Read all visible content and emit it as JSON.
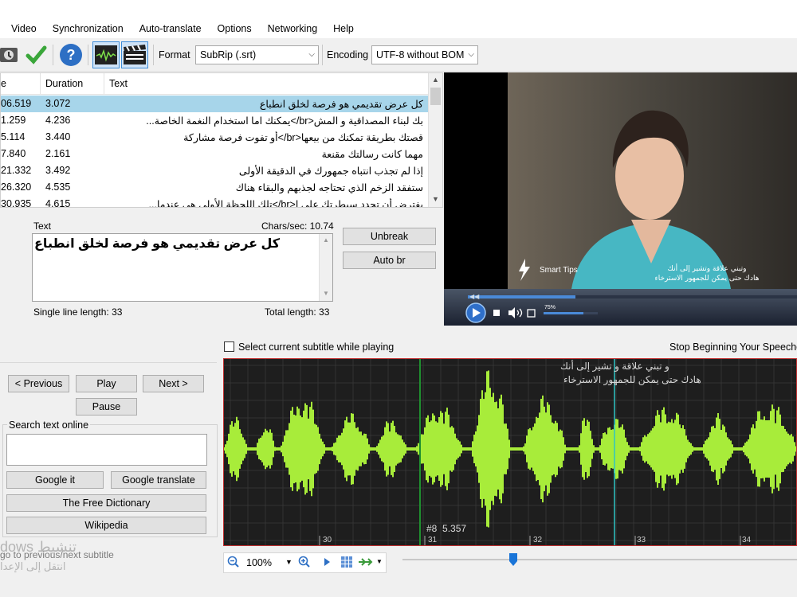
{
  "menu": [
    "Video",
    "Synchronization",
    "Auto-translate",
    "Options",
    "Networking",
    "Help"
  ],
  "toolbar": {
    "format_label": "Format",
    "format_value": "SubRip (.srt)",
    "encoding_label": "Encoding",
    "encoding_value": "UTF-8 without BOM"
  },
  "grid": {
    "headers": [
      "e",
      "Duration",
      "Text"
    ],
    "rows": [
      {
        "start": "06.519",
        "duration": "3.072",
        "text": "كل عرض تقديمي هو فرصة لخلق انطباع"
      },
      {
        "start": "1.259",
        "duration": "4.236",
        "text": "بك لبناء المصداقية و المش<br/>يمكنك اما استخدام النغمة الخاصة..."
      },
      {
        "start": "5.114",
        "duration": "3.440",
        "text": "قصتك بطريقة تمكنك من بيعها<br/>أو تفوت فرصة مشاركة"
      },
      {
        "start": "7.840",
        "duration": "2.161",
        "text": "مهما كانت رسالتك مقنعة"
      },
      {
        "start": "21.332",
        "duration": "3.492",
        "text": "إذا لم تجذب انتباه جمهورك في الدقيقة الأولى"
      },
      {
        "start": "26.320",
        "duration": "4.535",
        "text": "ستفقد الزخم الذي تحتاجه لجذبهم والبقاء هناك"
      },
      {
        "start": "30.935",
        "duration": "4.615",
        "text": "بفترض أن تحدد سيطرتك على ا<br/>تلك اللحظة الأولى هي عندما..."
      }
    ]
  },
  "editor": {
    "text_label": "Text",
    "chars_sec": "Chars/sec: 10.74",
    "text_value": "كل عرض تقديمي هو فرصة لخلق انطباع",
    "single_line_length": "Single line length: 33",
    "total_length": "Total length: 33",
    "unbreak": "Unbreak",
    "auto_br": "Auto br"
  },
  "video": {
    "subtitle_line1": "وتبني علاقة وتشير إلى أنك",
    "subtitle_line2": "هادك حتى يمكن للجمهور الاسترخاء",
    "watermark": "Smart Tips",
    "volume": "75%"
  },
  "controls": {
    "select_current": "Select current subtitle while playing",
    "stop_label": "Stop Beginning Your Speeche",
    "previous": "< Previous",
    "play": "Play",
    "next": "Next >",
    "pause": "Pause",
    "search_label": "Search text online",
    "google_it": "Google it",
    "google_translate": "Google translate",
    "free_dictionary": "The Free Dictionary",
    "wikipedia": "Wikipedia",
    "bottom_hint": "go to previous/next subtitle",
    "bottom_hint_ar": "انتقل إلى الإعدا",
    "windows_watermark": "dows تنشيط"
  },
  "waveform": {
    "sub_line1": "و تبني علاقة و تشير إلى أنك",
    "sub_line2": "هادك حتى يمكن للجمهور الاسترخاء",
    "marker": "#8  5.357",
    "ticks": [
      "30",
      "31",
      "32",
      "33",
      "34"
    ]
  },
  "zoom": {
    "value": "100%"
  },
  "colors": {
    "selection": "#a7d5ea",
    "wave": "#a8ec3a",
    "wave_border": "#c03030"
  }
}
